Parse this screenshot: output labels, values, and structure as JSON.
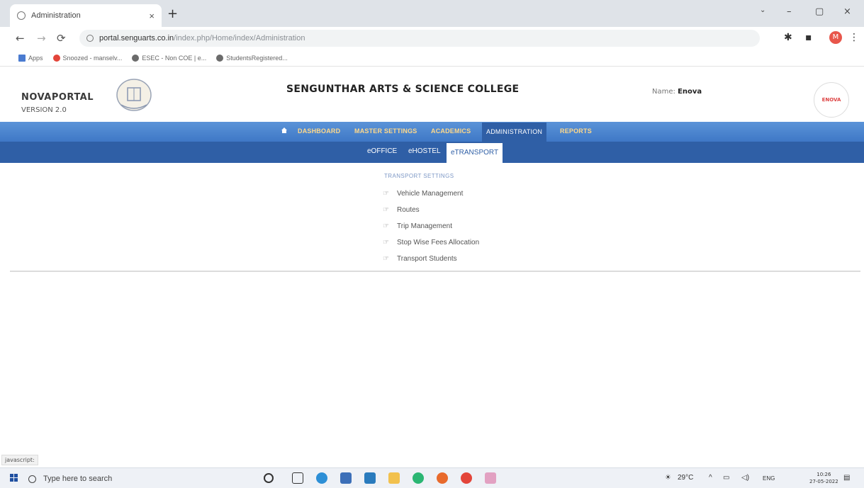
{
  "browser": {
    "tab_title": "Administration",
    "tab_close": "×",
    "new_tab": "+",
    "win_minimize": "–",
    "win_restore": "▢",
    "win_close": "×",
    "url_host": "portal.senguarts.co.in",
    "url_path": "/index.php/Home/index/Administration",
    "profile_initial": "M",
    "bookmarks": [
      {
        "label": "Apps",
        "color": "#4a7bd0"
      },
      {
        "label": "Snoozed - manselv...",
        "color": "#e3453a"
      },
      {
        "label": "ESEC - Non COE | e...",
        "color": "#6b6b6b"
      },
      {
        "label": "StudentsRegistered...",
        "color": "#6b6b6b"
      }
    ]
  },
  "header": {
    "brand": "NOVAPORTAL",
    "version": "VERSION 2.0",
    "college": "SENGUNTHAR ARTS & SCIENCE COLLEGE",
    "name_label": "Name:",
    "name_value": "Enova",
    "logo_text": "ENOVA"
  },
  "nav": {
    "items": [
      "DASHBOARD",
      "MASTER SETTINGS",
      "ACADEMICS",
      "ADMINISTRATION",
      "REPORTS"
    ],
    "active": "ADMINISTRATION"
  },
  "subnav": {
    "items": [
      "eOFFICE",
      "eHOSTEL",
      "eTRANSPORT"
    ],
    "active": "eTRANSPORT"
  },
  "content": {
    "section_title": "TRANSPORT SETTINGS",
    "links": [
      "Vehicle Management",
      "Routes",
      "Trip Management",
      "Stop Wise Fees Allocation",
      "Transport Students"
    ]
  },
  "status_text": "javascript:",
  "taskbar": {
    "search_placeholder": "Type here to search",
    "weather": "29°C",
    "lang": "ENG",
    "time": "10:26",
    "date": "27-05-2022"
  }
}
